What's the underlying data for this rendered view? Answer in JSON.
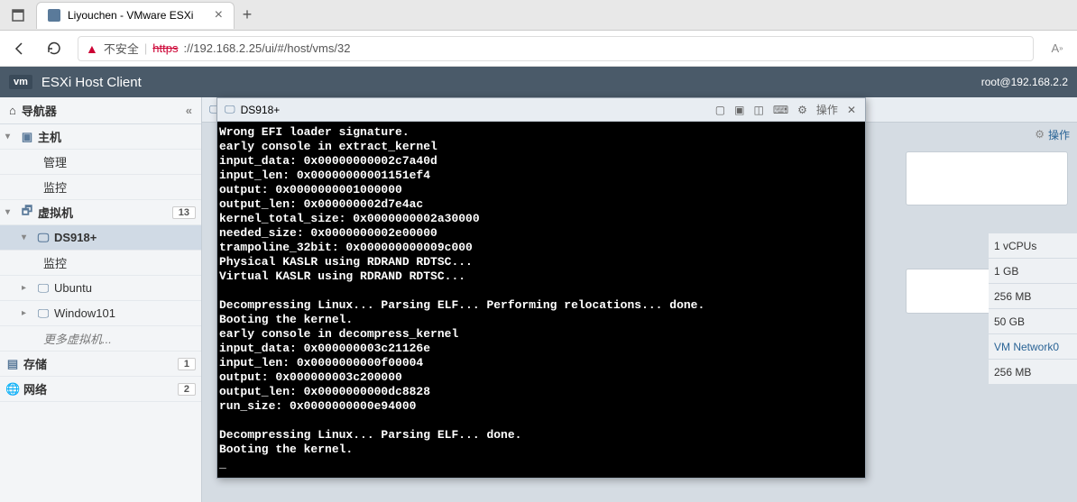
{
  "browser": {
    "tab_title": "Liyouchen - VMware ESXi",
    "url_insecure": "不安全",
    "url_https": "https",
    "url_rest": "://192.168.2.25/ui/#/host/vms/32"
  },
  "header": {
    "vm_badge": "vm",
    "title": "ESXi Host Client",
    "user": "root@192.168.2.2"
  },
  "sidebar": {
    "navigator": "导航器",
    "host": "主机",
    "manage": "管理",
    "monitor": "监控",
    "vms": "虚拟机",
    "vms_count": "13",
    "vm_selected": "DS918+",
    "vm_monitor": "监控",
    "vm_ubuntu": "Ubuntu",
    "vm_win101": "Window101",
    "more_vms": "更多虚拟机...",
    "storage": "存储",
    "storage_count": "1",
    "network": "网络",
    "network_count": "2"
  },
  "breadcrumb": {
    "vm_name": "DS918+"
  },
  "actions": {
    "label": "操作"
  },
  "console": {
    "title": "DS918+",
    "actions": "操作",
    "output": "Wrong EFI loader signature.\nearly console in extract_kernel\ninput_data: 0x00000000002c7a40d\ninput_len: 0x00000000001151ef4\noutput: 0x0000000001000000\noutput_len: 0x000000002d7e4ac\nkernel_total_size: 0x0000000002a30000\nneeded_size: 0x0000000002e00000\ntrampoline_32bit: 0x000000000009c000\nPhysical KASLR using RDRAND RDTSC...\nVirtual KASLR using RDRAND RDTSC...\n\nDecompressing Linux... Parsing ELF... Performing relocations... done.\nBooting the kernel.\nearly console in decompress_kernel\ninput_data: 0x000000003c21126e\ninput_len: 0x0000000000f00004\noutput: 0x000000003c200000\noutput_len: 0x0000000000dc8828\nrun_size: 0x0000000000e94000\n\nDecompressing Linux... Parsing ELF... done.\nBooting the kernel.\n_"
  },
  "info": {
    "cpus": "1 vCPUs",
    "mem": "1 GB",
    "disk1": "256 MB",
    "disk2": "50 GB",
    "net": "VM Network0",
    "disk3": "256 MB"
  }
}
